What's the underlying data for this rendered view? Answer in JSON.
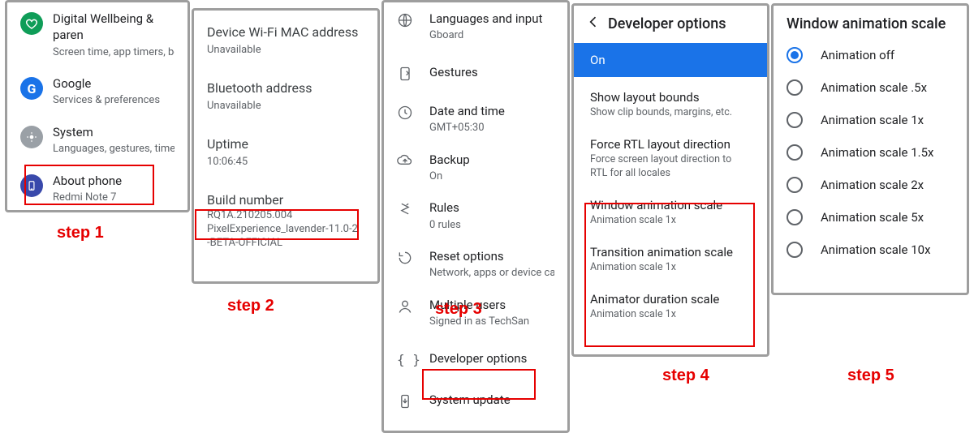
{
  "panel1": {
    "items": [
      {
        "title": "Digital Wellbeing & paren",
        "sub": "Screen time, app timers, bed"
      },
      {
        "title": "Google",
        "sub": "Services & preferences"
      },
      {
        "title": "System",
        "sub": "Languages, gestures, time, b"
      },
      {
        "title": "About phone",
        "sub": "Redmi Note 7"
      }
    ]
  },
  "panel2": {
    "items": [
      {
        "title": "Device Wi-Fi MAC address",
        "sub": "Unavailable"
      },
      {
        "title": "Bluetooth address",
        "sub": "Unavailable"
      },
      {
        "title": "Uptime",
        "sub": "10:06:45"
      },
      {
        "title": "Build number",
        "sub": "RQ1A.210205.004",
        "sub2": "PixelExperience_lavender-11.0-2",
        "sub3": "-BETA-OFFICIAL"
      }
    ]
  },
  "panel3": {
    "items": [
      {
        "title": "Languages and input",
        "sub": "Gboard"
      },
      {
        "title": "Gestures",
        "sub": ""
      },
      {
        "title": "Date and time",
        "sub": "GMT+05:30"
      },
      {
        "title": "Backup",
        "sub": "On"
      },
      {
        "title": "Rules",
        "sub": "0 rules"
      },
      {
        "title": "Reset options",
        "sub": "Network, apps or device can"
      },
      {
        "title": "Multiple users",
        "sub": "Signed in as TechSan"
      },
      {
        "title": "Developer options",
        "sub": ""
      },
      {
        "title": "System update",
        "sub": ""
      }
    ]
  },
  "panel4": {
    "header": "Developer options",
    "on": "On",
    "items": [
      {
        "t": "Show layout bounds",
        "s": "Show clip bounds, margins, etc."
      },
      {
        "t": "Force RTL layout direction",
        "s": "Force screen layout direction to RTL for all locales"
      },
      {
        "t": "Window animation scale",
        "s": "Animation scale 1x"
      },
      {
        "t": "Transition animation scale",
        "s": "Animation scale 1x"
      },
      {
        "t": "Animator duration scale",
        "s": "Animation scale 1x"
      }
    ]
  },
  "panel5": {
    "title": "Window animation scale",
    "options": [
      "Animation off",
      "Animation scale .5x",
      "Animation scale 1x",
      "Animation scale 1.5x",
      "Animation scale 2x",
      "Animation scale 5x",
      "Animation scale 10x"
    ],
    "selected": 0
  },
  "steps": {
    "s1": "step 1",
    "s2": "step 2",
    "s3": "step 3",
    "s4": "step 4",
    "s5": "step 5"
  }
}
